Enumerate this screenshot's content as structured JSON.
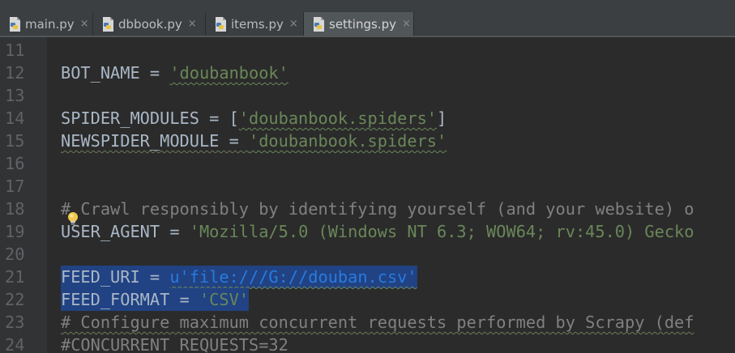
{
  "tabs": [
    {
      "label": "main.py",
      "active": false
    },
    {
      "label": "dbbook.py",
      "active": false
    },
    {
      "label": "items.py",
      "active": false
    },
    {
      "label": "settings.py",
      "active": true
    }
  ],
  "tab_close_glyph": "×",
  "icons": {
    "python_file": "python-file-icon",
    "close": "close-icon",
    "intention": "lightbulb-icon"
  },
  "colors": {
    "background": "#2b2b2b",
    "gutter": "#313335",
    "selection": "#214283",
    "string": "#6a8759",
    "unicode_string": "#287bde",
    "comment": "#808080",
    "text": "#a9b7c6"
  },
  "editor": {
    "lines": [
      {
        "number": "11",
        "tokens": []
      },
      {
        "number": "12",
        "tokens": [
          {
            "text": "BOT_NAME = "
          },
          {
            "text": "'doubanbook'",
            "kind": "str"
          }
        ]
      },
      {
        "number": "13",
        "tokens": []
      },
      {
        "number": "14",
        "tokens": [
          {
            "text": "SPIDER_MODULES = ["
          },
          {
            "text": "'doubanbook.spiders'",
            "kind": "str"
          },
          {
            "text": "]"
          }
        ]
      },
      {
        "number": "15",
        "tokens": [
          {
            "text": "NEWSPIDER_MODULE = "
          },
          {
            "text": "'doubanbook.spiders'",
            "kind": "str"
          }
        ]
      },
      {
        "number": "16",
        "tokens": []
      },
      {
        "number": "17",
        "tokens": []
      },
      {
        "number": "18",
        "tokens": [
          {
            "text": "# Crawl responsibly by identifying yourself (and your website) o",
            "kind": "com"
          }
        ]
      },
      {
        "number": "19",
        "tokens": [
          {
            "text": "USER_AGENT = "
          },
          {
            "text": "'Mozilla/5.0 (Windows NT 6.3; WOW64; rv:45.0) Gecko",
            "kind": "str"
          }
        ]
      },
      {
        "number": "20",
        "tokens": []
      },
      {
        "number": "21",
        "selected": true,
        "tokens": [
          {
            "text": "FEED_URI = "
          },
          {
            "text": "u'file:///G://douban.csv'",
            "kind": "ustr"
          }
        ]
      },
      {
        "number": "22",
        "selected": true,
        "tokens": [
          {
            "text": "FEED_FORMAT = "
          },
          {
            "text": "'CSV'",
            "kind": "str"
          }
        ]
      },
      {
        "number": "23",
        "tokens": [
          {
            "text": "# Configure maximum concurrent requests performed by Scrapy (def",
            "kind": "com"
          }
        ]
      },
      {
        "number": "24",
        "tokens": [
          {
            "text": "#CONCURRENT_REQUESTS=32",
            "kind": "com"
          }
        ]
      }
    ]
  }
}
